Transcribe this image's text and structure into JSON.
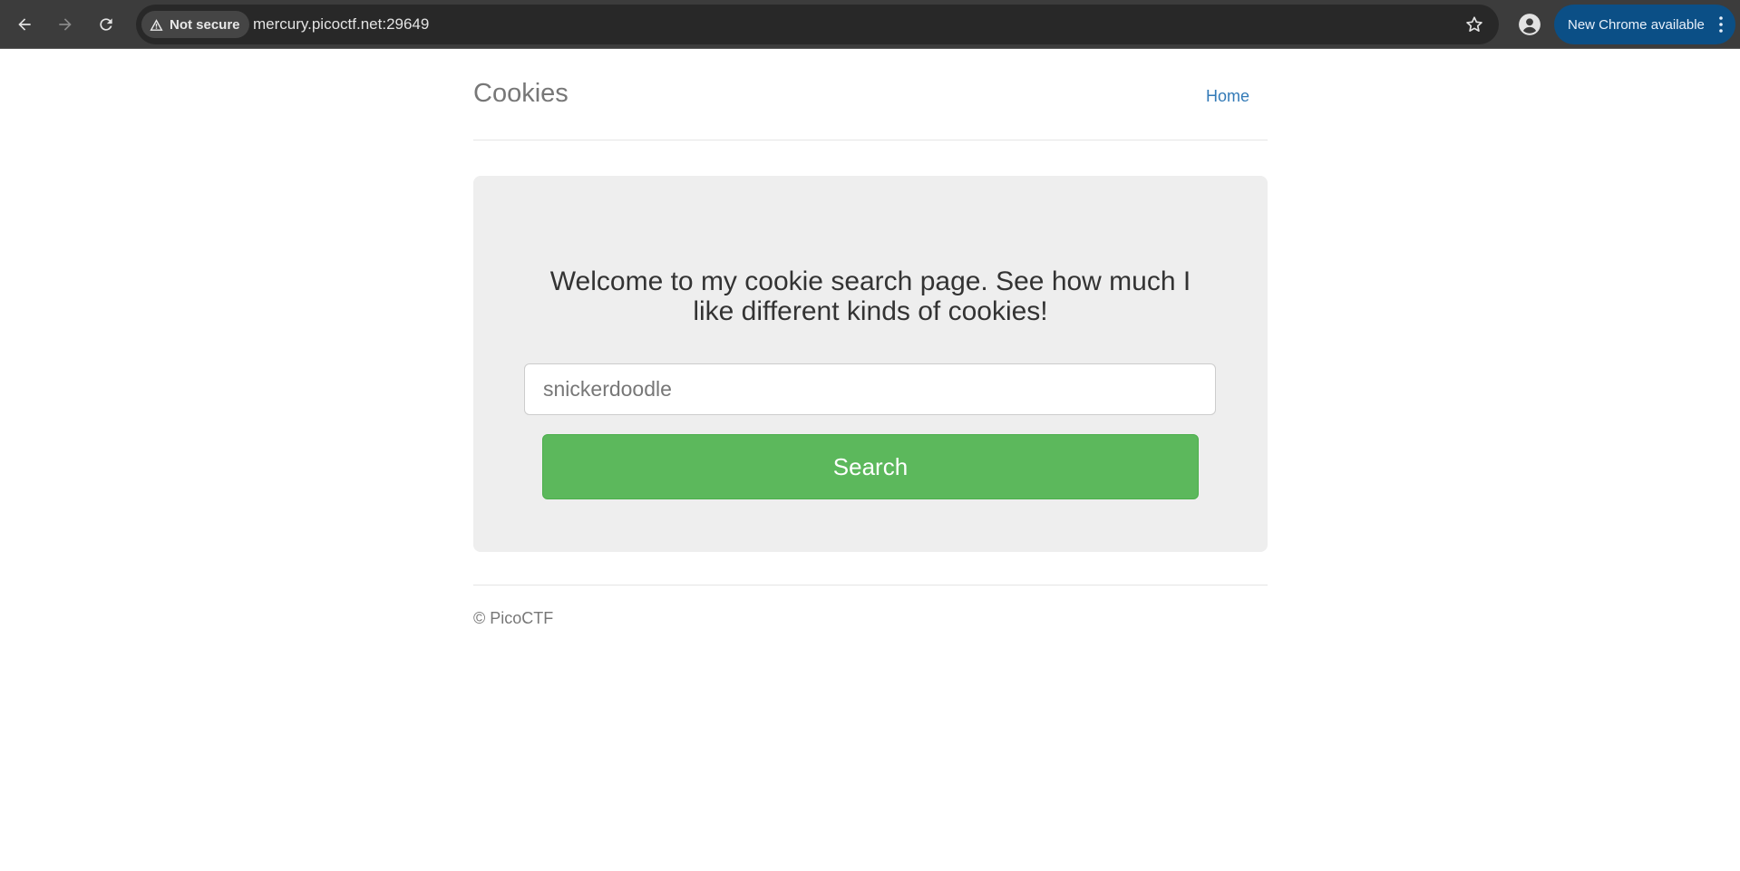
{
  "browser": {
    "security_label": "Not secure",
    "url": "mercury.picoctf.net:29649",
    "update_label": "New Chrome available",
    "icons": [
      "back-arrow-icon",
      "forward-arrow-icon",
      "reload-icon",
      "warning-triangle-icon",
      "star-icon",
      "profile-icon",
      "more-vert-icon"
    ]
  },
  "header": {
    "title": "Cookies",
    "home_link": "Home"
  },
  "main": {
    "welcome_text": "Welcome to my cookie search page. See how much I like different kinds of cookies!",
    "search_placeholder": "snickerdoodle",
    "search_value": "",
    "search_button": "Search"
  },
  "footer": {
    "copyright": "© PicoCTF"
  },
  "colors": {
    "chrome_bg": "#3c3c3c",
    "omnibox_bg": "#282828",
    "update_btn": "#0b4f86",
    "link": "#337ab7",
    "jumbotron_bg": "#eeeeee",
    "button_green": "#5cb85c"
  }
}
